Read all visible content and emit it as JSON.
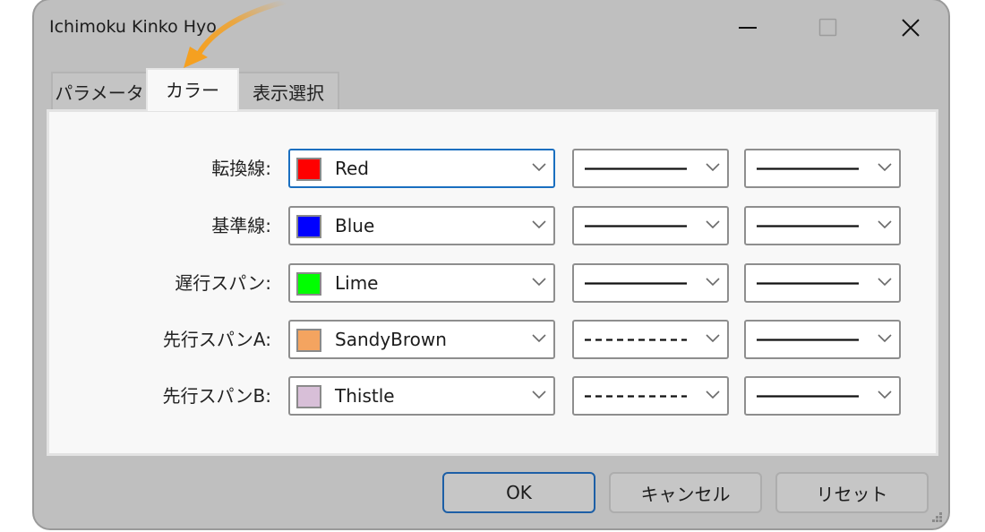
{
  "window": {
    "title": "Ichimoku Kinko Hyo",
    "controls": {
      "minimize": "minimize-icon",
      "maximize": "maximize-icon",
      "close": "close-icon"
    }
  },
  "tabs": [
    {
      "label": "パラメータ",
      "selected": false
    },
    {
      "label": "カラー",
      "selected": true
    },
    {
      "label": "表示選択",
      "selected": false
    }
  ],
  "rows": [
    {
      "label": "転換線:",
      "color_name": "Red",
      "color_hex": "#ff0000",
      "style": "solid",
      "width": "solid",
      "focused": true
    },
    {
      "label": "基準線:",
      "color_name": "Blue",
      "color_hex": "#0000ff",
      "style": "solid",
      "width": "solid",
      "focused": false
    },
    {
      "label": "遅行スパン:",
      "color_name": "Lime",
      "color_hex": "#00ff00",
      "style": "solid",
      "width": "solid",
      "focused": false
    },
    {
      "label": "先行スパンA:",
      "color_name": "SandyBrown",
      "color_hex": "#f4a460",
      "style": "dashed",
      "width": "solid",
      "focused": false
    },
    {
      "label": "先行スパンB:",
      "color_name": "Thistle",
      "color_hex": "#d8bfd8",
      "style": "dashed",
      "width": "solid",
      "focused": false
    }
  ],
  "buttons": {
    "ok": "OK",
    "cancel": "キャンセル",
    "reset": "リセット"
  },
  "annotation": {
    "arrow_color": "#f5a020",
    "points_to": "カラー"
  }
}
